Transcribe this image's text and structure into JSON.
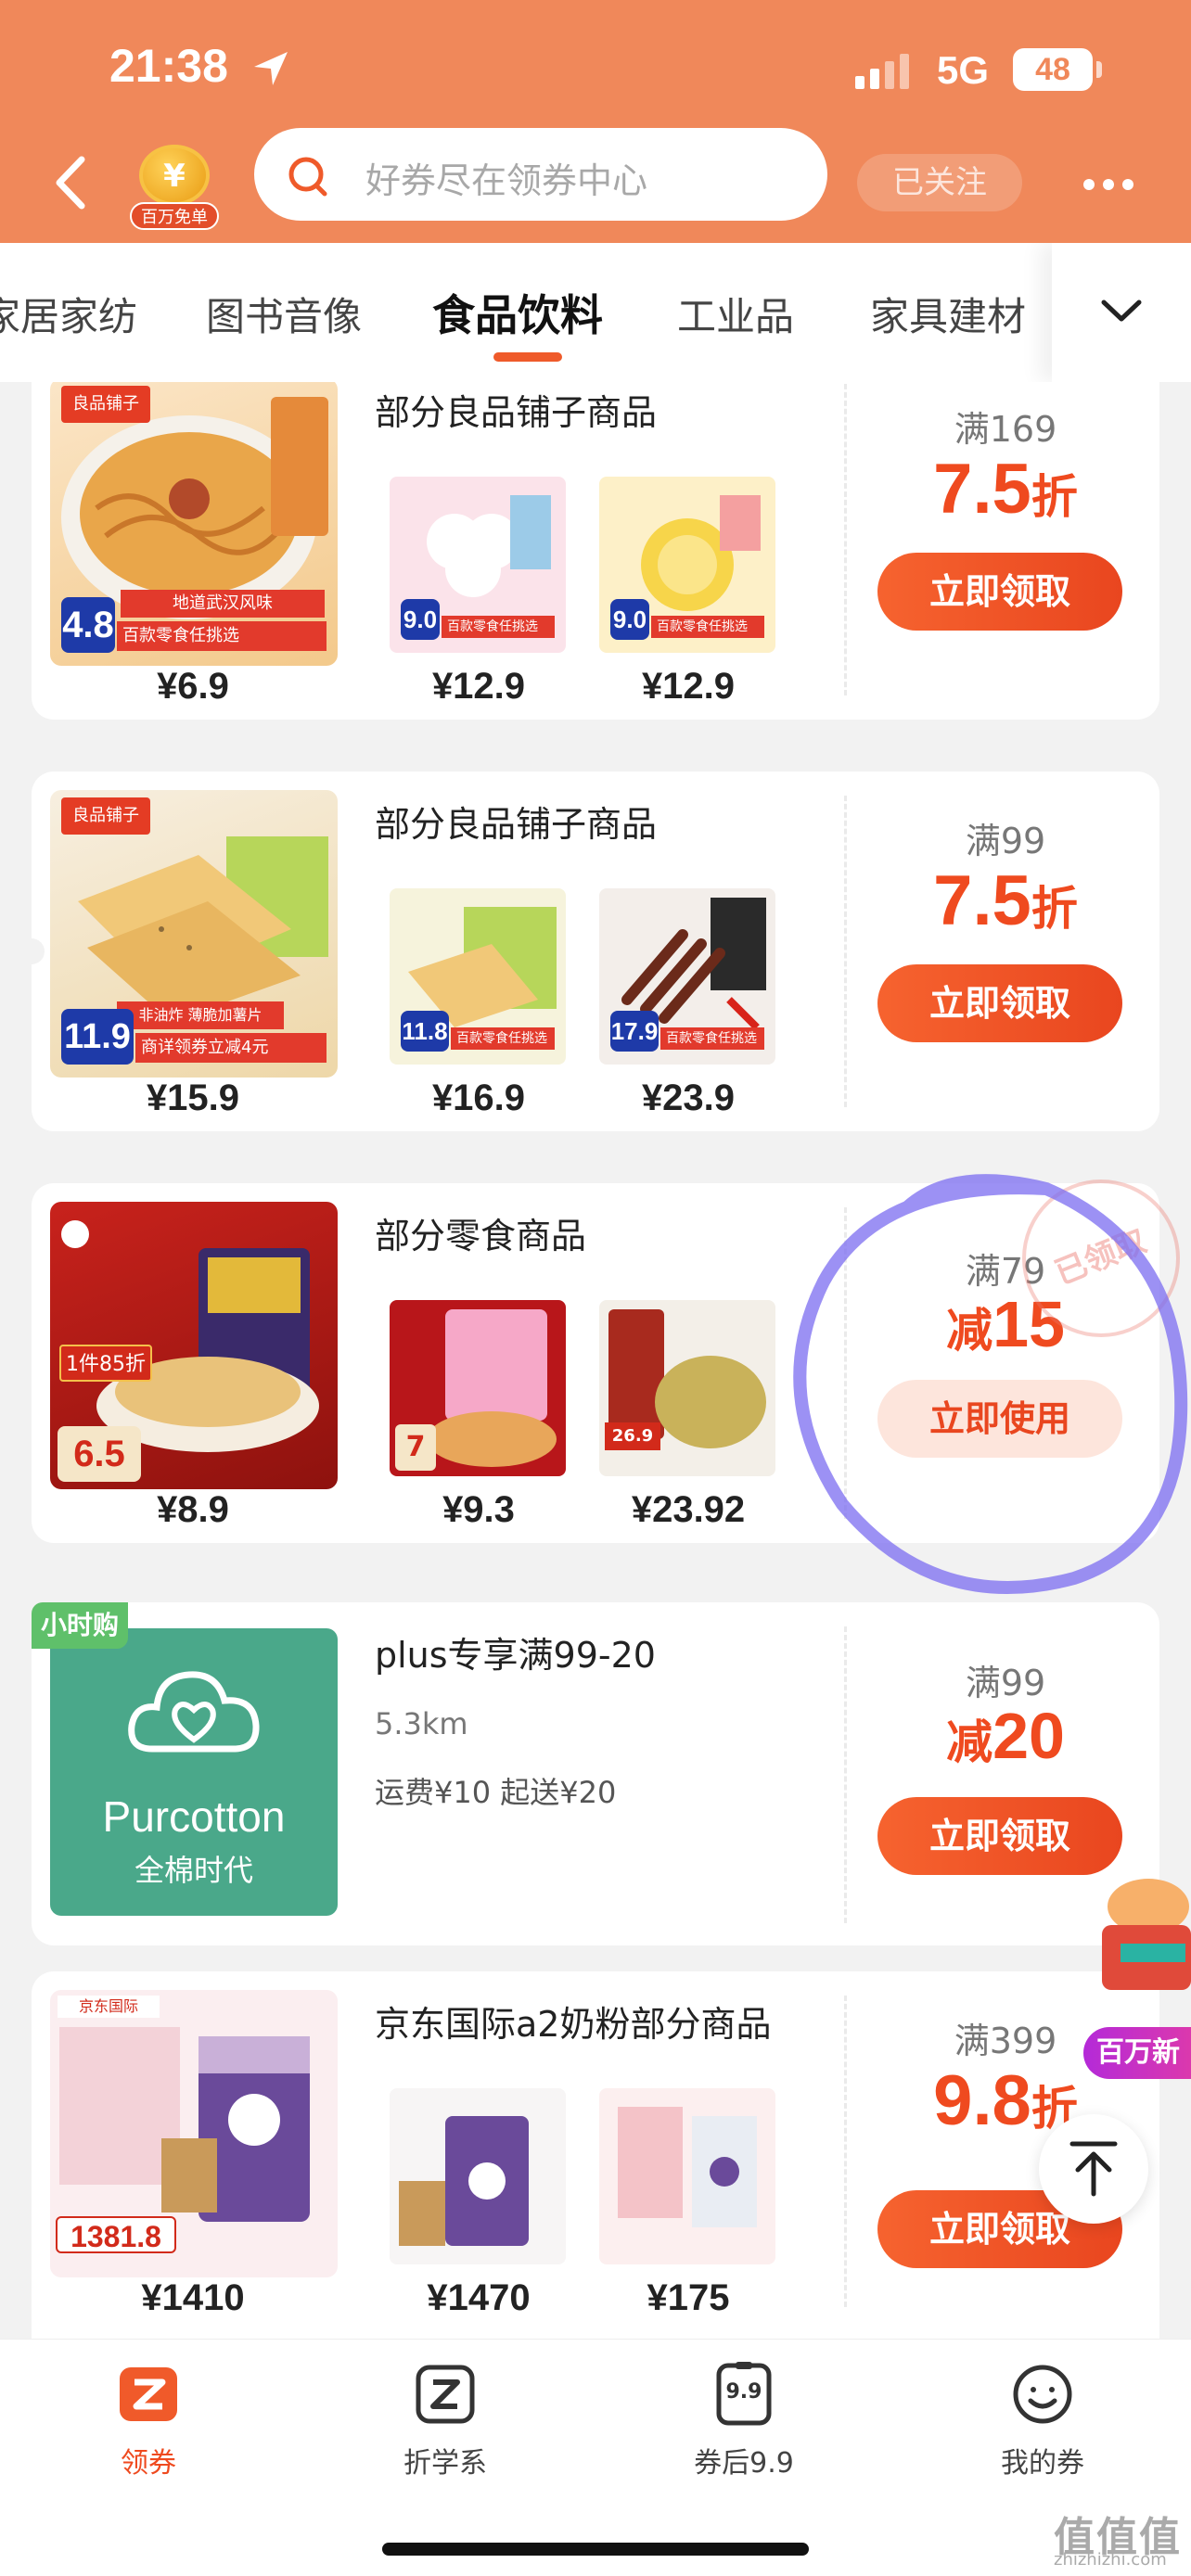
{
  "status": {
    "time": "21:38",
    "network": "5G",
    "battery": "48"
  },
  "header": {
    "badge_label": "百万免单",
    "badge_symbol": "¥",
    "search_placeholder": "好券尽在领券中心",
    "followed_label": "已关注"
  },
  "tabs": [
    "家居家纺",
    "图书音像",
    "食品饮料",
    "工业品",
    "家具建材"
  ],
  "active_tab": "食品饮料",
  "cards": [
    {
      "brand": "良品铺子",
      "title": "部分良品铺子商品",
      "main_score": "4.8",
      "main_ribbon": "百款零食任挑选",
      "main_note": "地道武汉风味",
      "prices": [
        "¥6.9",
        "¥12.9",
        "¥12.9"
      ],
      "thumb_scores": [
        "9.0",
        "9.0"
      ],
      "thumb_ribbon": "百款零食任挑选",
      "condition": "满169",
      "deal_number": "7.5",
      "deal_unit": "折",
      "cta": "立即领取"
    },
    {
      "brand": "良品铺子",
      "title": "部分良品铺子商品",
      "main_score": "11.9",
      "main_ribbon": "商详领券立减4元",
      "main_note": "非油炸 薄脆加薯片",
      "prices": [
        "¥15.9",
        "¥16.9",
        "¥23.9"
      ],
      "thumb_scores": [
        "11.8",
        "17.9"
      ],
      "thumb_ribbon": "百款零食任挑选",
      "condition": "满99",
      "deal_number": "7.5",
      "deal_unit": "折",
      "cta": "立即领取"
    },
    {
      "title": "部分零食商品",
      "main_tag": "1件85折",
      "main_price_tag": "6.5",
      "prices": [
        "¥8.9",
        "¥9.3",
        "¥23.92"
      ],
      "thumb_scores": [
        "7",
        "26.9"
      ],
      "condition": "满79",
      "deal_prefix": "减",
      "deal_number": "15",
      "cta": "立即使用",
      "stamp": "已领取"
    },
    {
      "hour_tag": "小时购",
      "title": "plus专享满99-20",
      "distance": "5.3km",
      "delivery": "运费¥10 起送¥20",
      "brand_en": "Purcotton",
      "brand_cn": "全棉时代",
      "condition": "满99",
      "deal_prefix": "减",
      "deal_number": "20",
      "cta": "立即领取"
    },
    {
      "title": "京东国际a2奶粉部分商品",
      "main_price_tag": "1381.8",
      "prices": [
        "¥1410",
        "¥1470",
        "¥175"
      ],
      "brand_tag": "京东国际",
      "condition": "满399",
      "deal_number": "9.8",
      "deal_unit": "折",
      "cta": "立即领取"
    }
  ],
  "floating_promo": "百万新",
  "bottom_nav": [
    {
      "label": "领券",
      "icon": "coupon-icon",
      "active": true
    },
    {
      "label": "折学系",
      "icon": "z-icon",
      "active": false
    },
    {
      "label": "券后9.9",
      "icon": "9.9-icon",
      "active": false,
      "icon_text": "9.9"
    },
    {
      "label": "我的券",
      "icon": "smile-icon",
      "active": false
    }
  ],
  "watermark": "值值值",
  "watermark_url": "zhizhizhi.com",
  "colors": {
    "header": "#f0885a",
    "accent": "#ef4a1f",
    "active_tab_underline": "#ef5a2a",
    "annotation": "#7b6cf0"
  }
}
